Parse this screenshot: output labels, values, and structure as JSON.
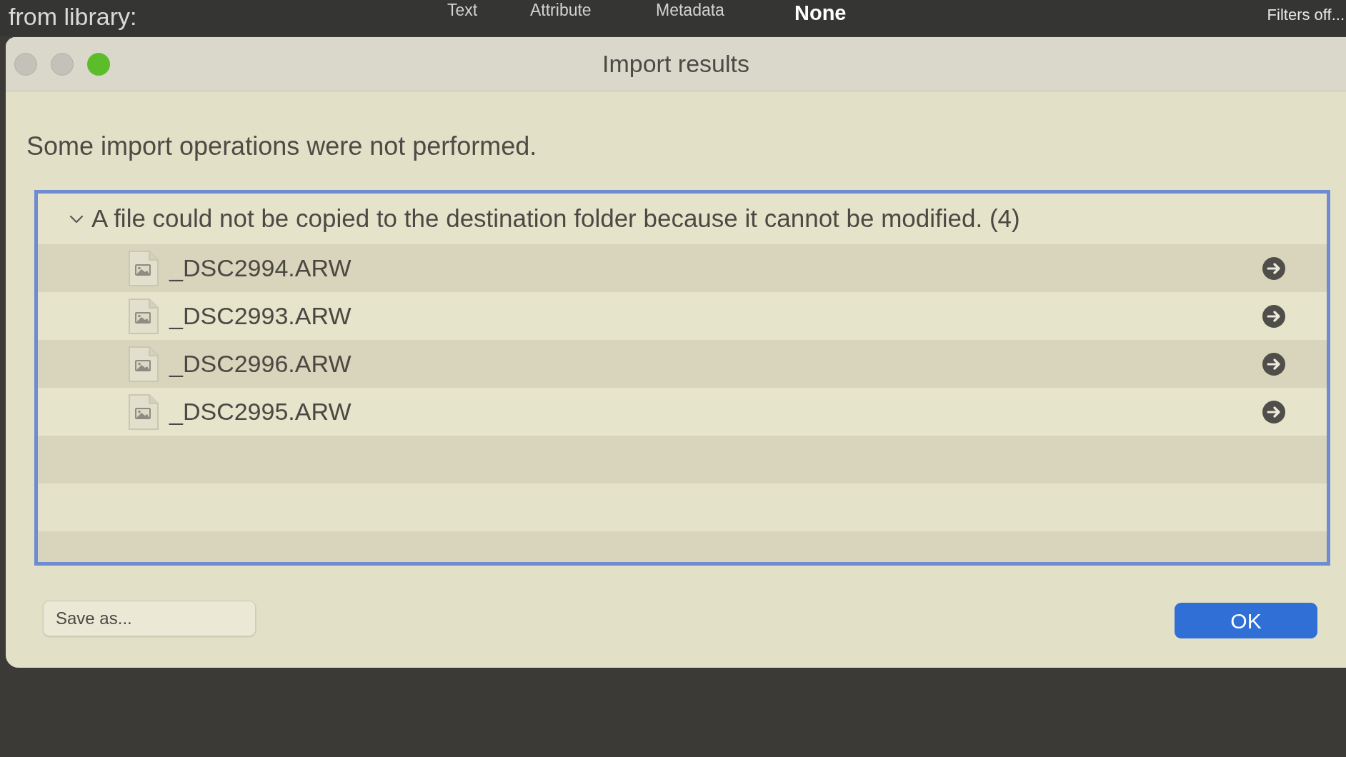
{
  "toolbar": {
    "title": "from library:",
    "tabs": [
      {
        "label": "Text",
        "selected": false
      },
      {
        "label": "Attribute",
        "selected": false
      },
      {
        "label": "Metadata",
        "selected": false
      },
      {
        "label": "None",
        "selected": true
      }
    ],
    "filters": "Filters off..."
  },
  "dialog": {
    "window_controls": [
      {
        "kind": "close",
        "disabled": true
      },
      {
        "kind": "minimize",
        "disabled": true
      },
      {
        "kind": "zoom",
        "disabled": false
      }
    ],
    "title": "Import results",
    "message": "Some import operations were not performed.",
    "groups": [
      {
        "label": "A file could not be copied to the destination folder because it cannot be modified. (4)",
        "expanded": true,
        "files": [
          {
            "name": "_DSC2994.ARW"
          },
          {
            "name": "_DSC2993.ARW"
          },
          {
            "name": "_DSC2996.ARW"
          },
          {
            "name": "_DSC2995.ARW"
          }
        ]
      }
    ],
    "buttons": [
      {
        "label": "Save as...",
        "kind": "secondary"
      },
      {
        "label": "OK",
        "kind": "primary"
      }
    ]
  }
}
